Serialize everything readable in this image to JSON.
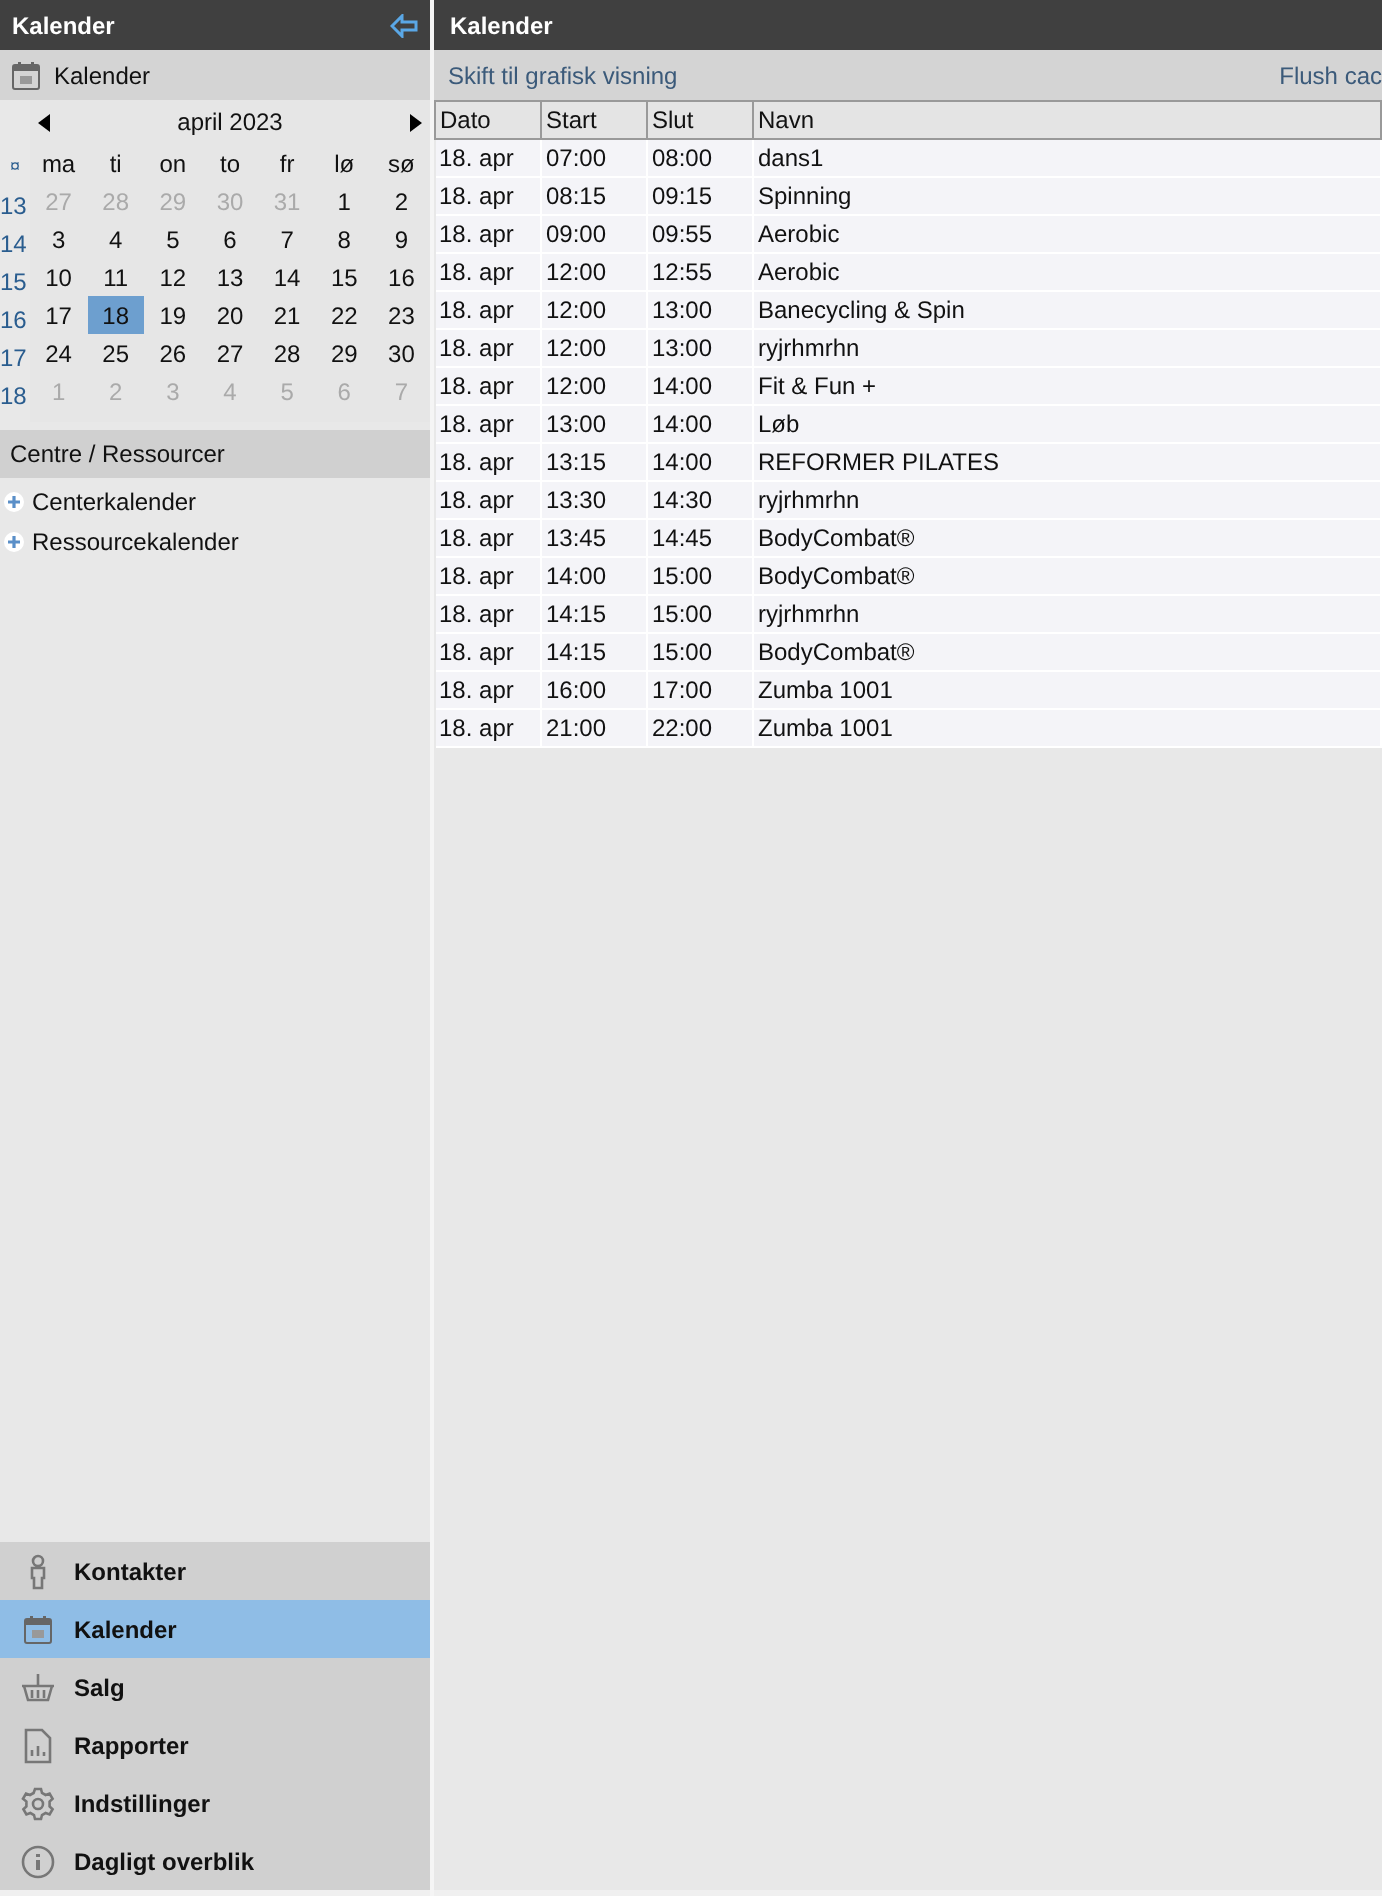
{
  "sidebar": {
    "title": "Kalender",
    "section_title": "Kalender",
    "calendar": {
      "month": "april 2023",
      "week_symbol": "¤",
      "weekdays": [
        "ma",
        "ti",
        "on",
        "to",
        "fr",
        "lø",
        "sø"
      ],
      "weeks": [
        {
          "number": "13",
          "days": [
            {
              "label": "27",
              "muted": true,
              "selected": false
            },
            {
              "label": "28",
              "muted": true,
              "selected": false
            },
            {
              "label": "29",
              "muted": true,
              "selected": false
            },
            {
              "label": "30",
              "muted": true,
              "selected": false
            },
            {
              "label": "31",
              "muted": true,
              "selected": false
            },
            {
              "label": "1",
              "muted": false,
              "selected": false
            },
            {
              "label": "2",
              "muted": false,
              "selected": false
            }
          ]
        },
        {
          "number": "14",
          "days": [
            {
              "label": "3",
              "muted": false,
              "selected": false
            },
            {
              "label": "4",
              "muted": false,
              "selected": false
            },
            {
              "label": "5",
              "muted": false,
              "selected": false
            },
            {
              "label": "6",
              "muted": false,
              "selected": false
            },
            {
              "label": "7",
              "muted": false,
              "selected": false
            },
            {
              "label": "8",
              "muted": false,
              "selected": false
            },
            {
              "label": "9",
              "muted": false,
              "selected": false
            }
          ]
        },
        {
          "number": "15",
          "days": [
            {
              "label": "10",
              "muted": false,
              "selected": false
            },
            {
              "label": "11",
              "muted": false,
              "selected": false
            },
            {
              "label": "12",
              "muted": false,
              "selected": false
            },
            {
              "label": "13",
              "muted": false,
              "selected": false
            },
            {
              "label": "14",
              "muted": false,
              "selected": false
            },
            {
              "label": "15",
              "muted": false,
              "selected": false
            },
            {
              "label": "16",
              "muted": false,
              "selected": false
            }
          ]
        },
        {
          "number": "16",
          "days": [
            {
              "label": "17",
              "muted": false,
              "selected": false
            },
            {
              "label": "18",
              "muted": false,
              "selected": true
            },
            {
              "label": "19",
              "muted": false,
              "selected": false
            },
            {
              "label": "20",
              "muted": false,
              "selected": false
            },
            {
              "label": "21",
              "muted": false,
              "selected": false
            },
            {
              "label": "22",
              "muted": false,
              "selected": false
            },
            {
              "label": "23",
              "muted": false,
              "selected": false
            }
          ]
        },
        {
          "number": "17",
          "days": [
            {
              "label": "24",
              "muted": false,
              "selected": false
            },
            {
              "label": "25",
              "muted": false,
              "selected": false
            },
            {
              "label": "26",
              "muted": false,
              "selected": false
            },
            {
              "label": "27",
              "muted": false,
              "selected": false
            },
            {
              "label": "28",
              "muted": false,
              "selected": false
            },
            {
              "label": "29",
              "muted": false,
              "selected": false
            },
            {
              "label": "30",
              "muted": false,
              "selected": false
            }
          ]
        },
        {
          "number": "18",
          "days": [
            {
              "label": "1",
              "muted": true,
              "selected": false
            },
            {
              "label": "2",
              "muted": true,
              "selected": false
            },
            {
              "label": "3",
              "muted": true,
              "selected": false
            },
            {
              "label": "4",
              "muted": true,
              "selected": false
            },
            {
              "label": "5",
              "muted": true,
              "selected": false
            },
            {
              "label": "6",
              "muted": true,
              "selected": false
            },
            {
              "label": "7",
              "muted": true,
              "selected": false
            }
          ]
        }
      ]
    },
    "resources_title": "Centre / Ressourcer",
    "tree": [
      {
        "label": "Centerkalender",
        "expanded": false
      },
      {
        "label": "Ressourcekalender",
        "expanded": false
      }
    ],
    "nav": [
      {
        "kind": "person",
        "label": "Kontakter",
        "selected": false
      },
      {
        "kind": "calendar",
        "label": "Kalender",
        "selected": true
      },
      {
        "kind": "basket",
        "label": "Salg",
        "selected": false
      },
      {
        "kind": "report",
        "label": "Rapporter",
        "selected": false
      },
      {
        "kind": "gear",
        "label": "Indstillinger",
        "selected": false
      },
      {
        "kind": "info",
        "label": "Dagligt overblik",
        "selected": false
      }
    ]
  },
  "main": {
    "title": "Kalender",
    "toolbar": {
      "left_link": "Skift til grafisk visning",
      "right_link": "Flush cac"
    },
    "table": {
      "columns": [
        "Dato",
        "Start",
        "Slut",
        "Navn"
      ],
      "rows": [
        [
          "18. apr",
          "07:00",
          "08:00",
          "dans1"
        ],
        [
          "18. apr",
          "08:15",
          "09:15",
          "Spinning"
        ],
        [
          "18. apr",
          "09:00",
          "09:55",
          "Aerobic"
        ],
        [
          "18. apr",
          "12:00",
          "12:55",
          "Aerobic"
        ],
        [
          "18. apr",
          "12:00",
          "13:00",
          "Banecycling & Spin"
        ],
        [
          "18. apr",
          "12:00",
          "13:00",
          "ryjrhmrhn"
        ],
        [
          "18. apr",
          "12:00",
          "14:00",
          "Fit & Fun +"
        ],
        [
          "18. apr",
          "13:00",
          "14:00",
          "Løb"
        ],
        [
          "18. apr",
          "13:15",
          "14:00",
          "REFORMER PILATES"
        ],
        [
          "18. apr",
          "13:30",
          "14:30",
          "ryjrhmrhn"
        ],
        [
          "18. apr",
          "13:45",
          "14:45",
          "BodyCombat®"
        ],
        [
          "18. apr",
          "14:00",
          "15:00",
          "BodyCombat®"
        ],
        [
          "18. apr",
          "14:15",
          "15:00",
          "ryjrhmrhn"
        ],
        [
          "18. apr",
          "14:15",
          "15:00",
          "BodyCombat®"
        ],
        [
          "18. apr",
          "16:00",
          "17:00",
          "Zumba 1001"
        ],
        [
          "18. apr",
          "21:00",
          "22:00",
          "Zumba 1001"
        ]
      ]
    }
  }
}
